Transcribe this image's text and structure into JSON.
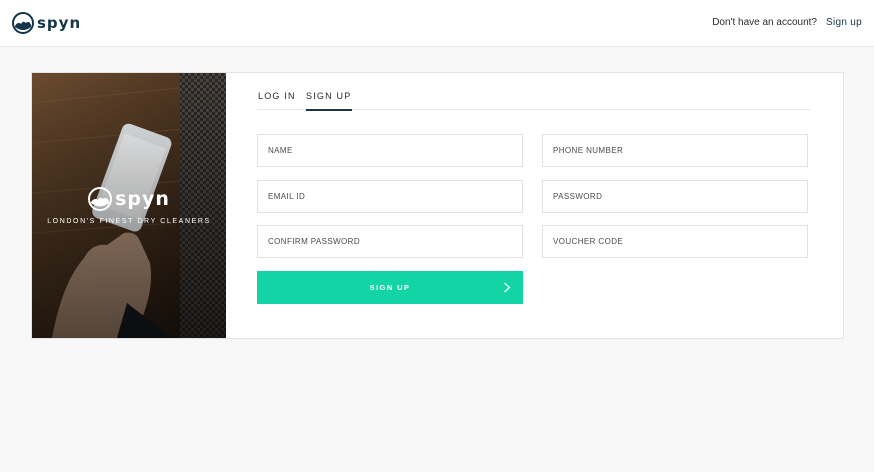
{
  "brand": {
    "name": "spyn",
    "tagline": "LONDON'S FINEST DRY CLEANERS"
  },
  "header": {
    "account_prompt": "Don't have an account?",
    "signup_link": "Sign up"
  },
  "tabs": [
    {
      "label": "LOG IN",
      "active": false
    },
    {
      "label": "SIGN UP",
      "active": true
    }
  ],
  "form": {
    "name_placeholder": "NAME",
    "phone_placeholder": "PHONE NUMBER",
    "email_placeholder": "EMAIL ID",
    "password_placeholder": "PASSWORD",
    "confirm_password_placeholder": "CONFIRM PASSWORD",
    "voucher_placeholder": "VOUCHER CODE",
    "submit_label": "SIGN UP"
  },
  "icons": {
    "logo": "spyn-logo-icon",
    "submit": "chevron-right-icon"
  },
  "colors": {
    "brand_navy": "#14344a",
    "accent_green": "#13d4a5",
    "background": "#f8f8f8"
  }
}
